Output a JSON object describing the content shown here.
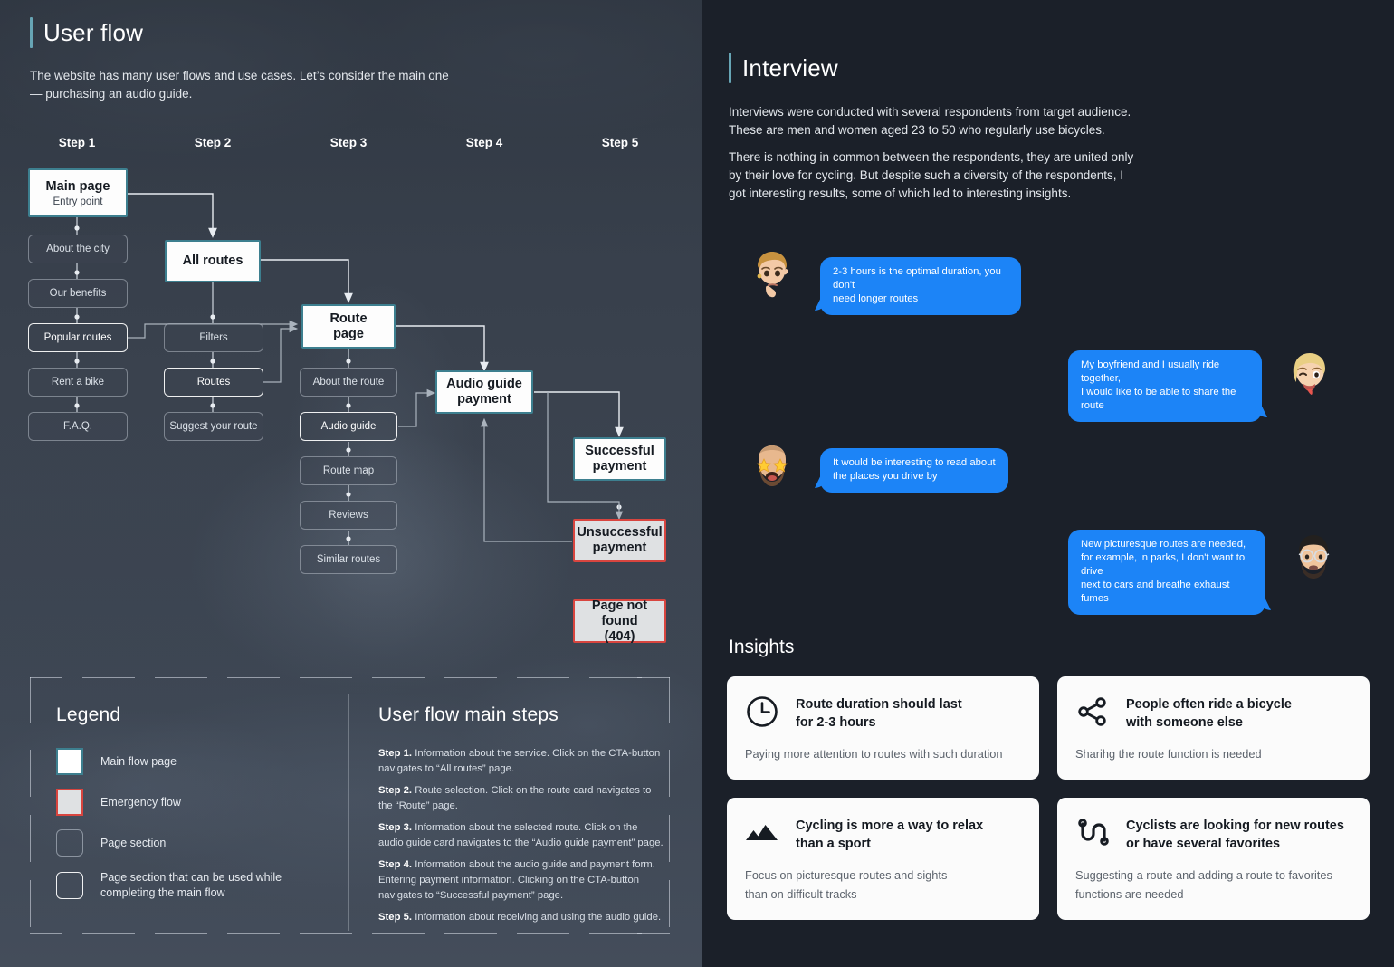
{
  "theme": {
    "left_panel_bg": "#39414d",
    "right_panel_bg": "#1b2029",
    "accent_teal": "#3d7f8f",
    "accent_red": "#d8453f",
    "bubble_blue": "#1c84f7",
    "card_bg": "#fbfbfb"
  },
  "user_flow": {
    "title": "User flow",
    "description": "The  website has many user flows and use cases. Let’s consider the main one — purchasing an audio guide.",
    "steps_header": [
      "Step 1",
      "Step 2",
      "Step 3",
      "Step 4",
      "Step 5"
    ],
    "nodes": {
      "main_page": {
        "title": "Main page",
        "subtitle": "Entry point"
      },
      "about_the_city": "About the city",
      "our_benefits": "Our benefits",
      "popular_routes": "Popular routes",
      "rent_a_bike": "Rent a bike",
      "faq": "F.A.Q.",
      "all_routes": "All routes",
      "filters": "Filters",
      "routes": "Routes",
      "suggest_your_route": "Suggest your route",
      "route_page": "Route\npage",
      "about_the_route": "About the route",
      "audio_guide": "Audio guide",
      "route_map": "Route map",
      "reviews": "Reviews",
      "similar_routes": "Similar routes",
      "audio_guide_payment": "Audio guide\npayment",
      "successful_payment": "Successful\npayment",
      "unsuccessful_payment": "Unsuccessful\npayment",
      "page_not_found": "Page not found\n(404)"
    }
  },
  "legend": {
    "title": "Legend",
    "items": [
      {
        "label": "Main flow page",
        "swatch": "main"
      },
      {
        "label": "Emergency flow",
        "swatch": "emerg"
      },
      {
        "label": "Page section",
        "swatch": "sec"
      },
      {
        "label": "Page section that can be used while completing the main flow",
        "swatch": "secb"
      }
    ]
  },
  "main_steps": {
    "title": "User flow main steps",
    "items": [
      {
        "label": "Step 1.",
        "text": "Information about the service. Click on the CTA-button navigates to “All routes” page."
      },
      {
        "label": "Step 2.",
        "text": "Route selection. Click on the route card navigates to the “Route” page."
      },
      {
        "label": "Step 3.",
        "text": "Information about the selected route. Click on the audio guide card navigates to the “Audio guide payment” page."
      },
      {
        "label": "Step 4.",
        "text": "Information about the audio guide and payment form. Entering payment information. Clicking on the CTA-button navigates to “Successful payment” page."
      },
      {
        "label": "Step 5.",
        "text": "Information about receiving and using the audio guide."
      }
    ]
  },
  "interview": {
    "title": "Interview",
    "paragraph1": "Interviews were conducted with several respondents from target audience. These are men and women aged 23 to 50 who regularly use bicycles.",
    "paragraph2": "There is nothing in common between the respondents, they are united only by their love for cycling. But despite such a diversity of the respondents, I got interesting results, some of which led to interesting insights.",
    "messages": [
      {
        "side": "left",
        "avatar": "woman-thinking-avatar",
        "text": "2-3 hours is the optimal duration, you don't\nneed longer routes"
      },
      {
        "side": "right",
        "avatar": "woman-winking-avatar",
        "text": "My boyfriend and I usually ride together,\nI would like to be able to share the route"
      },
      {
        "side": "left",
        "avatar": "man-star-eyes-avatar",
        "text": "It would be interesting to read about\nthe places you drive by"
      },
      {
        "side": "right",
        "avatar": "man-glasses-avatar",
        "text": "New picturesque routes are needed,\nfor example, in parks, I don't want to drive\nnext to cars and breathe exhaust fumes"
      }
    ]
  },
  "insights": {
    "title": "Insights",
    "cards": [
      {
        "icon": "clock-icon",
        "heading": "Route duration should last\nfor 2-3 hours",
        "sub": "Paying more attention to routes with such duration"
      },
      {
        "icon": "share-icon",
        "heading": "People often ride a bicycle\nwith someone else",
        "sub": "Sharihg the route function is needed"
      },
      {
        "icon": "mountain-icon",
        "heading": "Cycling is more a way to relax\nthan a sport",
        "sub": "Focus on picturesque routes and sights\nthan on difficult tracks"
      },
      {
        "icon": "route-icon",
        "heading": "Cyclists are looking for new routes\nor have several favorites",
        "sub": "Suggesting a route and adding a route to favorites\nfunctions are needed"
      }
    ]
  }
}
